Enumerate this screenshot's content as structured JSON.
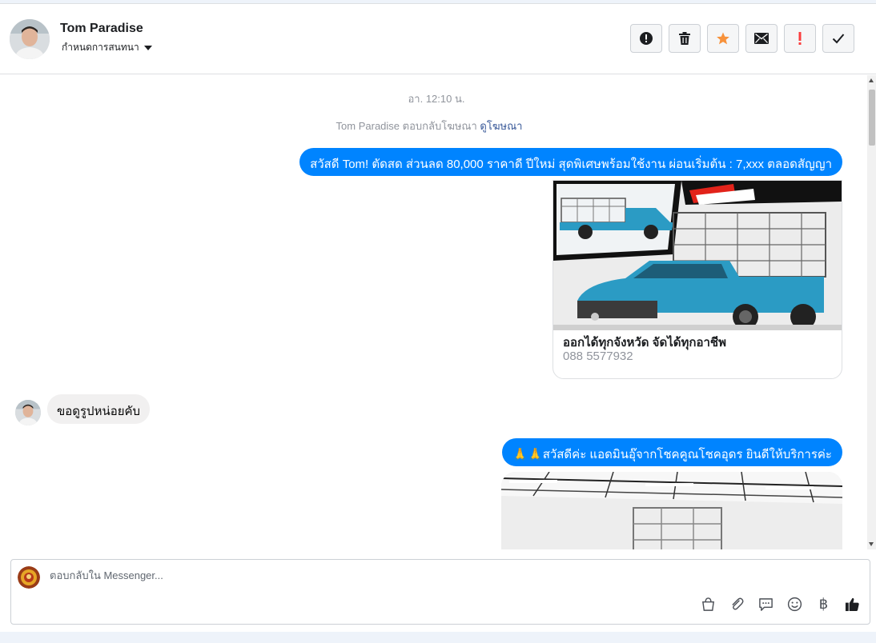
{
  "header": {
    "contact_name": "Tom Paradise",
    "assign_label": "กำหนดการสนทนา",
    "actions": [
      {
        "name": "spam-button",
        "icon": "alert-circle-icon"
      },
      {
        "name": "delete-button",
        "icon": "trash-icon"
      },
      {
        "name": "star-button",
        "icon": "star-icon",
        "color": "#f7923b"
      },
      {
        "name": "mark-unread-button",
        "icon": "envelope-icon"
      },
      {
        "name": "follow-up-button",
        "icon": "exclamation-icon",
        "color": "#fa3e3e"
      },
      {
        "name": "mark-done-button",
        "icon": "check-icon"
      }
    ]
  },
  "conversation": {
    "timestamp": "อา. 12:10 น.",
    "ad_reply_prefix": "Tom Paradise ตอบกลับโฆษณา",
    "ad_reply_link": "ดูโฆษณา",
    "messages": {
      "m1": "สวัสดี Tom! ตัดสด ส่วนลด 80,000 ราคาดี ปีใหม่ สุดพิเศษพร้อมใช้งาน ผ่อนเริ่มต้น :  7,xxx ตลอดสัญญา",
      "card_title": "ออกได้ทุกจังหวัด จัดได้ทุกอาชีพ",
      "card_subtitle": "088 5577932",
      "m2": "ขอดูรูปหน่อยคับ",
      "m3": "🙏🙏สวัสดีค่ะ แอดมินอุ๊จากโชคคูณโชคอุดร ยินดีให้บริการค่ะ"
    },
    "colors": {
      "outgoing": "#0084ff",
      "incoming": "#f1f0f0",
      "truck": "#2b9bc4"
    }
  },
  "composer": {
    "placeholder": "ตอบกลับใน Messenger...",
    "tools": [
      "bag-icon",
      "paperclip-icon",
      "chat-bubble-icon",
      "smiley-icon",
      "baht-icon",
      "thumbs-up-icon"
    ],
    "baht_symbol": "฿"
  }
}
